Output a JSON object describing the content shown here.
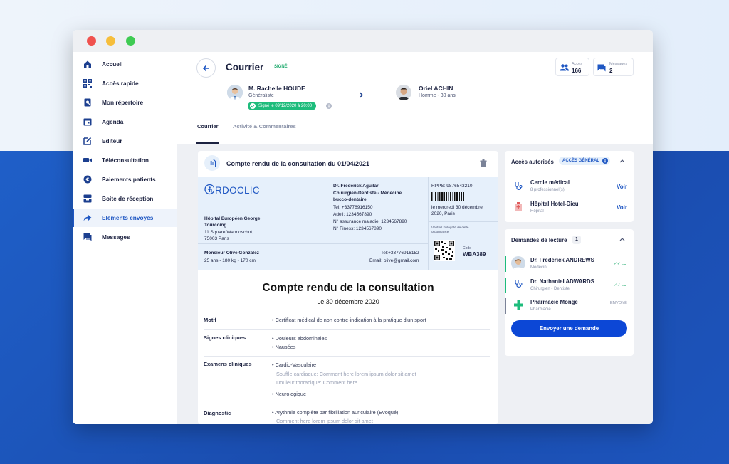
{
  "sidebar": {
    "items": [
      {
        "label": "Accueil",
        "icon": "home-icon"
      },
      {
        "label": "Accès rapide",
        "icon": "qr-icon"
      },
      {
        "label": "Mon répertoire",
        "icon": "directory-icon"
      },
      {
        "label": "Agenda",
        "icon": "calendar-icon"
      },
      {
        "label": "Editeur",
        "icon": "edit-icon"
      },
      {
        "label": "Téléconsultation",
        "icon": "video-icon"
      },
      {
        "label": "Paiements patients",
        "icon": "euro-icon"
      },
      {
        "label": "Boite de réception",
        "icon": "inbox-icon"
      },
      {
        "label": "Eléments envoyés",
        "icon": "send-icon",
        "active": true
      },
      {
        "label": "Messages",
        "icon": "chat-icon"
      }
    ]
  },
  "header": {
    "title": "Courrier",
    "status": "SIGNÉ",
    "acces": {
      "label": "Accès",
      "value": "166"
    },
    "messages": {
      "label": "Messages",
      "value": "2"
    },
    "sender": {
      "name": "M. Rachelle HOUDE",
      "role": "Généraliste",
      "signed": "Signé le 09/12/2020 à 20:00"
    },
    "recipient": {
      "name": "Oriel ACHIN",
      "info": "Homme - 30 ans"
    },
    "tabs": [
      "Courrier",
      "Activité & Commentaires"
    ]
  },
  "doc": {
    "card_title": "Compte rendu de la consultation du 01/04/2021",
    "logo": "RDOCLIC",
    "hospital": {
      "name1": "Hôpital Européen George",
      "name2": "Tourcoing",
      "addr1": "11 Square Wannoschot,",
      "addr2": "75003 Paris"
    },
    "doctor": {
      "name": "Dr. Frederick Aguilar",
      "spec1": "Chirurgien-Dentiste - Médecine",
      "spec2": "bucco-dentaire",
      "tel": "Tel: +33776916150",
      "adeli": "Adeli: 1234567890",
      "assurance": "N° assurance maladie: 1234567890",
      "finess": "N° Finess: 1234567890"
    },
    "rpps": "RPPS: 9876543210",
    "date_line1": "le mercredi 30 décembre",
    "date_line2": "2020, Paris",
    "verify1": "Vérifiez l'intégrité de cette",
    "verify2": "ordonnance",
    "code_label": "Code",
    "code": "WBA389",
    "patient": {
      "name": "Monsieur Olive Gonzalez",
      "info": "25 ans - 180 kg - 170 cm",
      "tel": "Tel:+33776916152",
      "email": "Email: olive@gmail.com"
    },
    "heading": "Compte rendu de la consultation",
    "date": "Le 30 décembre 2020",
    "motif": {
      "label": "Motif",
      "item": "Certificat médical de non contre-indication à la pratique d'un sport"
    },
    "signes": {
      "label": "Signes cliniques",
      "items": [
        "Douleurs abdominales",
        "Nausées"
      ]
    },
    "examens": {
      "label": "Examens cliniques",
      "item1": "Cardio-Vasculaire",
      "note1": "Souffle cardiaque: Comment here lorem ipsum dolor sit amet",
      "note2": "Douleur thoracique: Comment here",
      "item2": "Neurologique"
    },
    "diagnostic": {
      "label": "Diagnostic",
      "item": "Arythmie complète par fibrillation auriculaire (Evoqué)",
      "note": "Comment here lorem ipsum dolor sit amet"
    }
  },
  "acces": {
    "title": "Accès autorisés",
    "badge": "ACCÈS GÉNÉRAL",
    "rows": [
      {
        "name": "Cercle médical",
        "sub": "8 professionnel(s)",
        "action": "Voir"
      },
      {
        "name": "Hôpital Hotel-Dieu",
        "sub": "Hôpital",
        "action": "Voir"
      }
    ]
  },
  "demandes": {
    "title": "Demandes de lecture",
    "count": "1",
    "rows": [
      {
        "name": "Dr. Frederick ANDREWS",
        "sub": "Médecin",
        "status": "LU"
      },
      {
        "name": "Dr. Nathaniel ADWARDS",
        "sub": "Chirurgien - Dentiste",
        "status": "LU"
      },
      {
        "name": "Pharmacie Monge",
        "sub": "Pharmacie",
        "status": "ENVOYÉ"
      }
    ],
    "button": "Envoyer une demande"
  },
  "colors": {
    "primary": "#1f57c3",
    "green": "#1ebc7c",
    "button": "#0c47d6"
  }
}
